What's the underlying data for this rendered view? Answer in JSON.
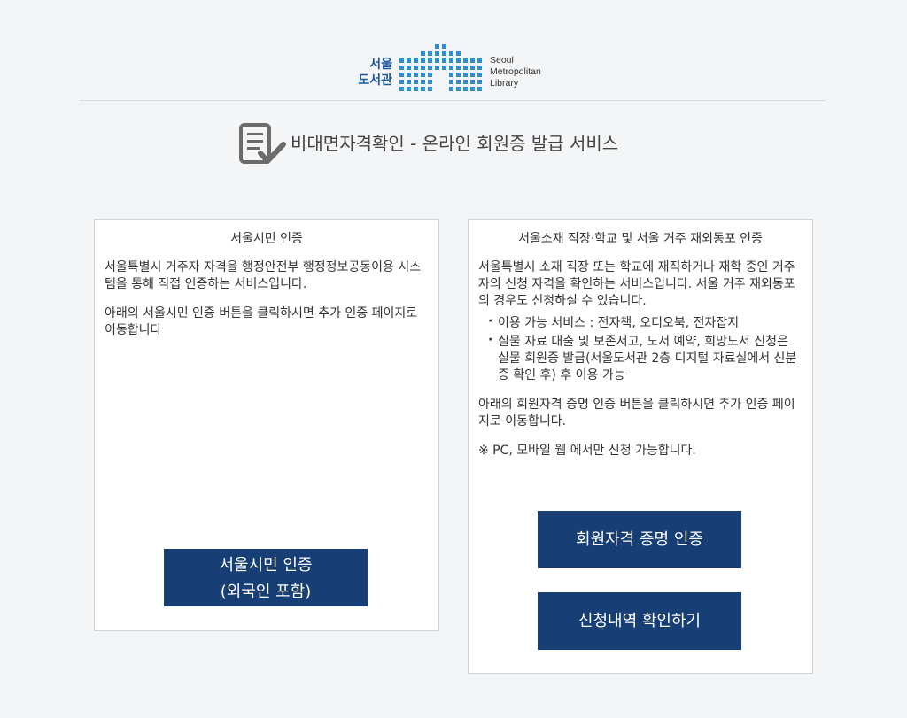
{
  "logo": {
    "ko_line1": "서울",
    "ko_line2": "도서관",
    "en_line1": "Seoul",
    "en_line2": "Metropolitan",
    "en_line3": "Library",
    "color": "#1e5aa0"
  },
  "page": {
    "title": "비대면자격확인 - 온라인 회원증 발급 서비스",
    "title_icon": "document-check-icon"
  },
  "left_card": {
    "title": "서울시민 인증",
    "paragraph1": "서울특별시 거주자 자격을 행정안전부 행정정보공동이용 시스템을 통해 직접 인증하는 서비스입니다.",
    "paragraph2": "아래의 서울시민 인증 버튼을 클릭하시면 추가 인증 페이지로 이동합니다",
    "button_line1": "서울시민 인증",
    "button_line2": "(외국인 포함)"
  },
  "right_card": {
    "title": "서울소재 직장·학교 및 서울 거주 재외동포 인증",
    "paragraph1": "서울특별시 소재 직장 또는 학교에 재직하거나 재학 중인 거주자의 신청 자격을 확인하는 서비스입니다. 서울 거주 재외동포의 경우도 신청하실 수 있습니다.",
    "bullets": [
      "이용 가능 서비스 : 전자책, 오디오북, 전자잡지",
      "실물 자료 대출 및 보존서고, 도서 예약, 희망도서 신청은 실물 회원증 발급(서울도서관 2층 디지털 자료실에서 신분증 확인 후) 후 이용 가능"
    ],
    "paragraph2": "아래의 회원자격 증명 인증 버튼을 클릭하시면 추가 인증 페이지로 이동합니다.",
    "note": "※ PC, 모바일 웹 에서만 신청 가능합니다.",
    "button_verify": "회원자격 증명 인증",
    "button_history": "신청내역 확인하기"
  },
  "colors": {
    "button_bg": "#173f75",
    "background": "#f4f5f7"
  }
}
